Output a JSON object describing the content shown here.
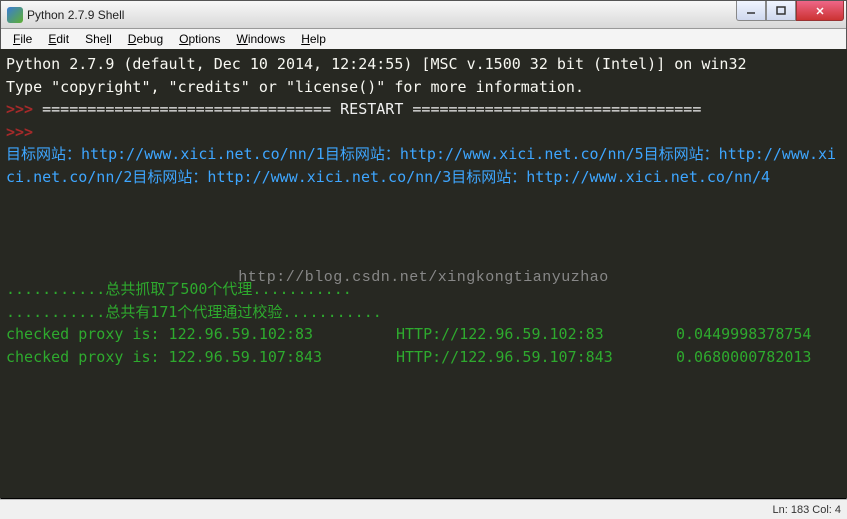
{
  "window": {
    "title": "Python 2.7.9 Shell"
  },
  "menu": {
    "items": [
      "File",
      "Edit",
      "Shell",
      "Debug",
      "Options",
      "Windows",
      "Help"
    ]
  },
  "console": {
    "banner1": "Python 2.7.9 (default, Dec 10 2014, 12:24:55) [MSC v.1500 32 bit (Intel)] on win32",
    "banner2": "Type \"copyright\", \"credits\" or \"license()\" for more information.",
    "prompt": ">>> ",
    "restart": "================================ RESTART ================================",
    "targets_text": "目标网站：http://www.xici.net.co/nn/1目标网站：http://www.xici.net.co/nn/5目标网站：http://www.xici.net.co/nn/2目标网站：http://www.xici.net.co/nn/3目标网站：http://www.xici.net.co/nn/4",
    "summary1": "...........总共抓取了500个代理...........",
    "summary2": "...........总共有171个代理通过校验...........",
    "proxy1_a": "checked proxy is: 122.96.59.102:83",
    "proxy1_b": "HTTP://122.96.59.102:83",
    "proxy1_c": "0.0449998378754",
    "proxy2_a": "checked proxy is: 122.96.59.107:843",
    "proxy2_b": "HTTP://122.96.59.107:843",
    "proxy2_c": "0.0680000782013"
  },
  "watermark": "http://blog.csdn.net/xingkongtianyuzhao",
  "status": {
    "text": "Ln: 183 Col: 4"
  }
}
